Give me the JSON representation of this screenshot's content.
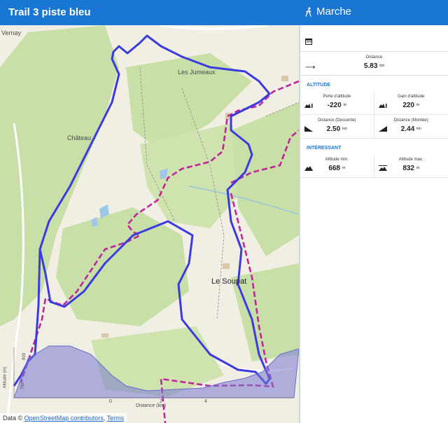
{
  "header": {
    "title": "Trail 3 piste bleu",
    "activity": "Marche"
  },
  "map": {
    "places": {
      "main_village": "Le Soupat",
      "hamlet_1": "Les Jumeaux",
      "hamlet_2": "Château",
      "north_village": "Vernay"
    },
    "elevation_chart": {
      "xlabel": "Distance (km)",
      "ylabel": "Altitude (m)",
      "x_ticks": [
        "0",
        "2",
        "4"
      ],
      "y_ticks": [
        "750",
        "800"
      ]
    },
    "attribution": {
      "prefix": "Data ©",
      "osm_link": "OpenStreetMap contributors",
      "separator": ",",
      "terms_link": "Terms"
    },
    "colors": {
      "route": "#3a3ae0",
      "dashed_trail": "#c0269b",
      "forest": "#c9dfa8",
      "chart_fill": "#8c8ed8"
    }
  },
  "stats": {
    "distance": {
      "label": "Distance",
      "value": "5.83",
      "unit": "km"
    },
    "altitude_section": "ALTITUDE",
    "altitude": [
      {
        "label": "Perte d'altitude",
        "value": "-220",
        "unit": "m"
      },
      {
        "label": "Gain d'altitude",
        "value": "220",
        "unit": "m"
      },
      {
        "label": "Distance (Descente)",
        "value": "2.50",
        "unit": "km"
      },
      {
        "label": "Distance (Montée)",
        "value": "2.44",
        "unit": "km"
      }
    ],
    "interest_section": "INTÉRESSANT",
    "interest": [
      {
        "label": "Altitude min.",
        "value": "668",
        "unit": "m"
      },
      {
        "label": "Altitude max.",
        "value": "832",
        "unit": "m"
      }
    ]
  }
}
